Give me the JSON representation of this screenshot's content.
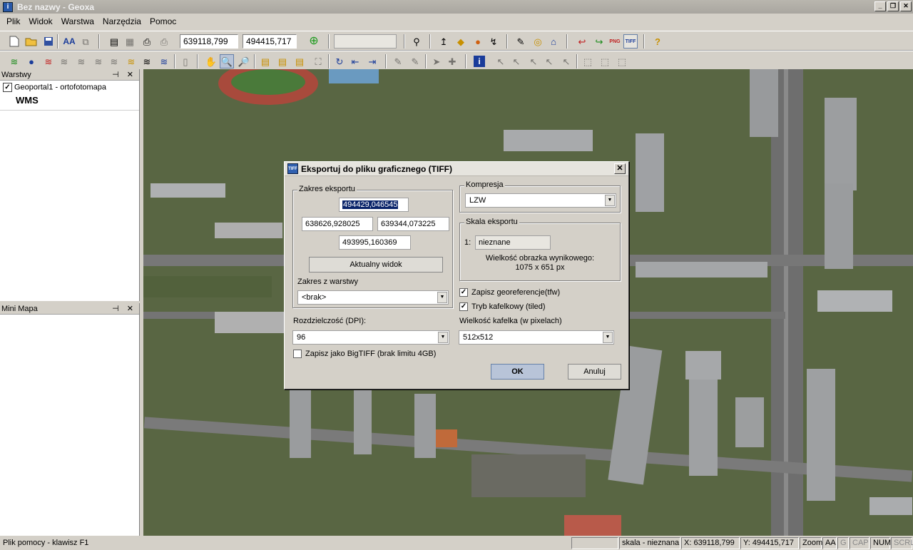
{
  "window": {
    "title": "Bez nazwy - Geoxa",
    "min": "_",
    "restore": "❐",
    "close": "✕"
  },
  "menu": [
    "Plik",
    "Widok",
    "Warstwa",
    "Narzędzia",
    "Pomoc"
  ],
  "toolbar": {
    "coord_x": "639118,799",
    "coord_y": "494415,717",
    "aa_label": "AA",
    "png_badge": "PNG",
    "tiff_badge": "TIFF"
  },
  "layers_panel": {
    "title": "Warstwy",
    "pin": "⊣",
    "close": "✕",
    "items": [
      {
        "checked": "✓",
        "label": "Geoportal1 - ortofotomapa",
        "sublabel": "WMS"
      }
    ]
  },
  "minimap_panel": {
    "title": "Mini Mapa"
  },
  "dialog": {
    "title": "Eksportuj do pliku graficznego (TIFF)",
    "icon_text": "TIFF",
    "close": "✕",
    "extent_group": "Zakres eksportu",
    "north": "494429,046545",
    "west": "638626,928025",
    "east": "639344,073225",
    "south": "493995,160369",
    "current_view_button": "Aktualny widok",
    "layer_extent_label": "Zakres z warstwy",
    "layer_extent_value": "<brak>",
    "compression_group": "Kompresja",
    "compression_value": "LZW",
    "scale_group": "Skala eksportu",
    "scale_prefix": "1:",
    "scale_value": "nieznane",
    "output_size_label": "Wielkość obrazka wynikowego:",
    "output_size_value": "1075 x 651 px",
    "save_georef": {
      "label": "Zapisz georeferencje(tfw)",
      "checked": "✓"
    },
    "tiled_mode": {
      "label": "Tryb kafelkowy (tiled)",
      "checked": "✓"
    },
    "dpi_label": "Rozdzielczość (DPI):",
    "dpi_value": "96",
    "tile_size_label": "Wielkość kafelka (w pixelach)",
    "tile_size_value": "512x512",
    "bigtiff_label": "Zapisz jako BigTIFF (brak limitu 4GB)",
    "ok_button": "OK",
    "cancel_button": "Anuluj"
  },
  "status": {
    "help": "Plik pomocy - klawisz F1",
    "scale": "skala - nieznana",
    "x": "X: 639118,799",
    "y": "Y: 494415,717",
    "zoom": "Zoom",
    "aa": "AA",
    "g": "G",
    "cap": "CAP",
    "num": "NUM",
    "scrl": "SCRL"
  }
}
